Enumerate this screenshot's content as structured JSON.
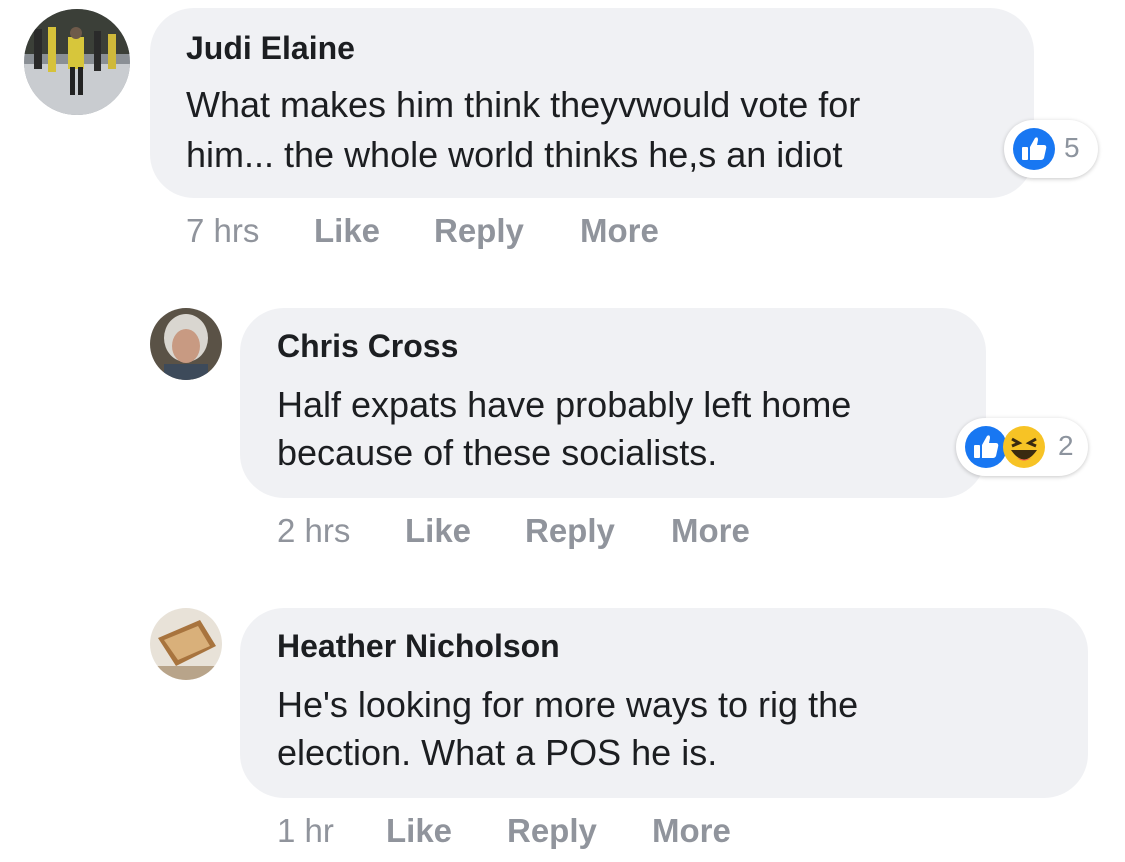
{
  "comments": [
    {
      "author": "Judi Elaine",
      "lines": [
        "What makes him think theyvwould vote for",
        "him... the whole world thinks he,s an idiot"
      ],
      "time": "7 hrs",
      "like": "Like",
      "reply": "Reply",
      "more": "More",
      "reactions": {
        "icons": [
          "like-icon"
        ],
        "count": "5"
      }
    },
    {
      "author": "Chris Cross",
      "lines": [
        "Half expats have probably left home",
        "because of these socialists."
      ],
      "time": "2 hrs",
      "like": "Like",
      "reply": "Reply",
      "more": "More",
      "reactions": {
        "icons": [
          "like-icon",
          "laugh-icon"
        ],
        "count": "2"
      }
    },
    {
      "author": "Heather Nicholson",
      "lines": [
        "He's looking for more ways to rig the",
        "election. What a POS he is."
      ],
      "time": "1 hr",
      "like": "Like",
      "reply": "Reply",
      "more": "More"
    }
  ],
  "colors": {
    "bubble": "#f0f1f4",
    "like_blue": "#1877f2",
    "action_gray": "#90949c"
  }
}
